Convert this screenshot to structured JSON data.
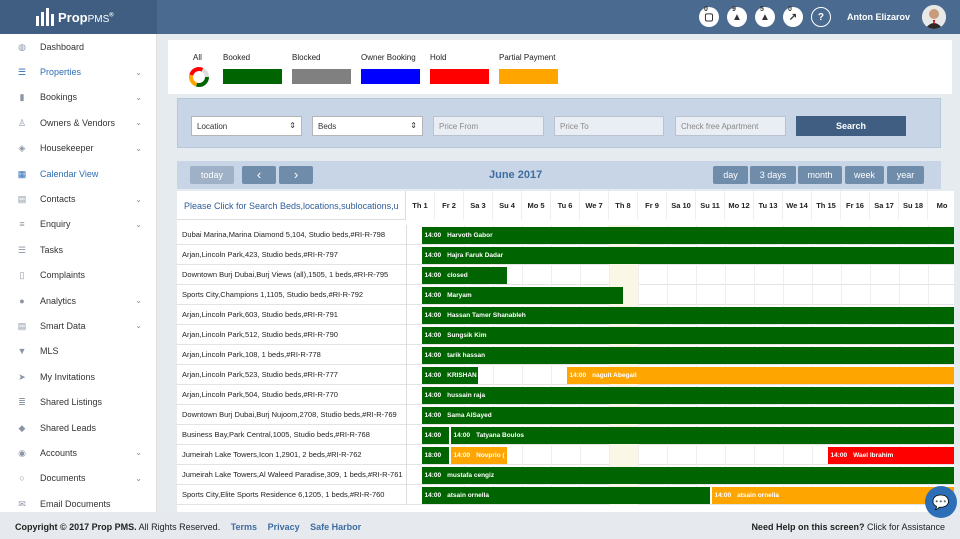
{
  "app": {
    "logo_main": "Prop",
    "logo_sub": "PMS",
    "logo_reg": "®"
  },
  "topbar": {
    "badges": [
      {
        "icon": "camera-icon",
        "count": "0"
      },
      {
        "icon": "person-icon",
        "count": "9"
      },
      {
        "icon": "alert-icon",
        "count": "5"
      },
      {
        "icon": "chart-icon",
        "count": "0"
      }
    ],
    "help": "?",
    "user": "Anton Elizarov"
  },
  "sidebar": {
    "items": [
      {
        "label": "Dashboard",
        "icon": "dashboard-icon",
        "chev": false
      },
      {
        "label": "Properties",
        "icon": "properties-icon",
        "chev": true,
        "active": true
      },
      {
        "label": "Bookings",
        "icon": "bookmark-icon",
        "chev": true
      },
      {
        "label": "Owners & Vendors",
        "icon": "owners-icon",
        "chev": true
      },
      {
        "label": "Housekeeper",
        "icon": "box-icon",
        "chev": true
      },
      {
        "label": "Calendar View",
        "icon": "calendar-icon",
        "chev": false,
        "active": true
      },
      {
        "label": "Contacts",
        "icon": "contacts-icon",
        "chev": true
      },
      {
        "label": "Enquiry",
        "icon": "enquiry-icon",
        "chev": true
      },
      {
        "label": "Tasks",
        "icon": "tasks-icon",
        "chev": false
      },
      {
        "label": "Complaints",
        "icon": "complaints-icon",
        "chev": false
      },
      {
        "label": "Analytics",
        "icon": "analytics-icon",
        "chev": true
      },
      {
        "label": "Smart Data",
        "icon": "smartdata-icon",
        "chev": true
      },
      {
        "label": "MLS",
        "icon": "filter-icon",
        "chev": false
      },
      {
        "label": "My Invitations",
        "icon": "send-icon",
        "chev": false
      },
      {
        "label": "Shared Listings",
        "icon": "list-icon",
        "chev": false
      },
      {
        "label": "Shared Leads",
        "icon": "tag-icon",
        "chev": false
      },
      {
        "label": "Accounts",
        "icon": "accounts-icon",
        "chev": true
      },
      {
        "label": "Documents",
        "icon": "documents-icon",
        "chev": true
      },
      {
        "label": "Email Documents",
        "icon": "email-icon",
        "chev": false
      }
    ]
  },
  "legend": {
    "all": "All",
    "items": [
      {
        "label": "Booked",
        "color": "#006400"
      },
      {
        "label": "Blocked",
        "color": "#808080"
      },
      {
        "label": "Owner Booking",
        "color": "#0000ff"
      },
      {
        "label": "Hold",
        "color": "#ff0000"
      },
      {
        "label": "Partial Payment",
        "color": "#ffa500"
      }
    ]
  },
  "search": {
    "location": "Location",
    "beds": "Beds",
    "price_from": "Price From",
    "price_to": "Price To",
    "check_free": "Check free Apartment",
    "button": "Search"
  },
  "calendar": {
    "today": "today",
    "prev": "‹",
    "next": "›",
    "title": "June 2017",
    "views": [
      "day",
      "3 days",
      "month",
      "week",
      "year"
    ],
    "search_hint": "Please Click for Search Beds,locations,sublocations,u",
    "days": [
      "Th 1",
      "Fr 2",
      "Sa 3",
      "Su 4",
      "Mo 5",
      "Tu 6",
      "We 7",
      "Th 8",
      "Fr 9",
      "Sa 10",
      "Su 11",
      "Mo 12",
      "Tu 13",
      "We 14",
      "Th 15",
      "Fr 16",
      "Sa 17",
      "Su 18",
      "Mo"
    ]
  },
  "rows": [
    {
      "label": "Dubai Marina,Marina Diamond 5,104, Studio beds,#RI-R-798",
      "bars": [
        {
          "start": 0.5,
          "end": 19,
          "color": "#006400",
          "time": "14:00",
          "name": "Harvoth Gabor"
        }
      ]
    },
    {
      "label": "Arjan,Lincoln Park,423, Studio beds,#RI-R-797",
      "bars": [
        {
          "start": 0.5,
          "end": 19,
          "color": "#006400",
          "time": "14:00",
          "name": "Hajra Faruk Dadar"
        }
      ]
    },
    {
      "label": "Downtown Burj Dubai,Burj Views (all),1505, 1 beds,#RI-R-795",
      "bars": [
        {
          "start": 0.5,
          "end": 3.5,
          "color": "#006400",
          "time": "14:00",
          "name": "closed"
        }
      ]
    },
    {
      "label": "Sports City,Champions 1,1105, Studio beds,#RI-R-792",
      "bars": [
        {
          "start": 0.5,
          "end": 7.5,
          "color": "#006400",
          "time": "14:00",
          "name": "Maryam"
        }
      ]
    },
    {
      "label": "Arjan,Lincoln Park,603, Studio beds,#RI-R-791",
      "bars": [
        {
          "start": 0.5,
          "end": 19,
          "color": "#006400",
          "time": "14:00",
          "name": "Hassan Tamer Shanableh"
        }
      ]
    },
    {
      "label": "Arjan,Lincoln Park,512, Studio beds,#RI-R-790",
      "bars": [
        {
          "start": 0.5,
          "end": 19,
          "color": "#006400",
          "time": "14:00",
          "name": "Sungsik Kim"
        }
      ]
    },
    {
      "label": "Arjan,Lincoln Park,108, 1 beds,#RI-R-778",
      "bars": [
        {
          "start": 0.5,
          "end": 19,
          "color": "#006400",
          "time": "14:00",
          "name": "tarik hassan"
        }
      ]
    },
    {
      "label": "Arjan,Lincoln Park,523, Studio beds,#RI-R-777",
      "bars": [
        {
          "start": 0.5,
          "end": 2.5,
          "color": "#006400",
          "time": "14:00",
          "name": "KRISHAN"
        },
        {
          "start": 5.5,
          "end": 19,
          "color": "#ffa500",
          "time": "14:00",
          "name": "naguit Abegail"
        }
      ]
    },
    {
      "label": "Arjan,Lincoln Park,504, Studio beds,#RI-R-770",
      "bars": [
        {
          "start": 0.5,
          "end": 19,
          "color": "#006400",
          "time": "14:00",
          "name": "hussain raja"
        }
      ]
    },
    {
      "label": "Downtown Burj Dubai,Burj Nujoom,2708, Studio beds,#RI-R-769",
      "bars": [
        {
          "start": 0.5,
          "end": 19,
          "color": "#006400",
          "time": "14:00",
          "name": "Sama AlSayed"
        }
      ]
    },
    {
      "label": "Business Bay,Park Central,1005, Studio beds,#RI-R-768",
      "bars": [
        {
          "start": 0.5,
          "end": 1.5,
          "color": "#006400",
          "time": "14:00",
          "name": ""
        },
        {
          "start": 1.5,
          "end": 19,
          "color": "#006400",
          "time": "14:00",
          "name": "Tatyana Boulos"
        }
      ]
    },
    {
      "label": "Jumeirah Lake Towers,Icon 1,2901, 2 beds,#RI-R-762",
      "bars": [
        {
          "start": 0.5,
          "end": 1.5,
          "color": "#006400",
          "time": "18:00",
          "name": ""
        },
        {
          "start": 1.5,
          "end": 3.5,
          "color": "#ffa500",
          "time": "14:00",
          "name": "Novprio ("
        },
        {
          "start": 14.5,
          "end": 19,
          "color": "#ff0000",
          "time": "14:00",
          "name": "Wael Ibrahim"
        }
      ]
    },
    {
      "label": "Jumeirah Lake Towers,Al Waleed Paradise,309, 1 beds,#RI-R-761",
      "bars": [
        {
          "start": 0.5,
          "end": 19,
          "color": "#006400",
          "time": "14:00",
          "name": "mustafa cengiz"
        }
      ]
    },
    {
      "label": "Sports City,Elite Sports Residence 6,1205, 1 beds,#RI-R-760",
      "bars": [
        {
          "start": 0.5,
          "end": 10.5,
          "color": "#006400",
          "time": "14:00",
          "name": "atsain ornella"
        },
        {
          "start": 10.5,
          "end": 19,
          "color": "#ffa500",
          "time": "14:00",
          "name": "atsain ornella"
        }
      ]
    }
  ],
  "footer": {
    "copyright_bold": "Copyright © 2017 Prop PMS.",
    "copyright_rest": " All Rights Reserved.",
    "terms": "Terms",
    "privacy": "Privacy",
    "safe_harbor": "Safe Harbor",
    "help_bold": "Need Help on this screen?",
    "help_rest": " Click for Assistance"
  }
}
